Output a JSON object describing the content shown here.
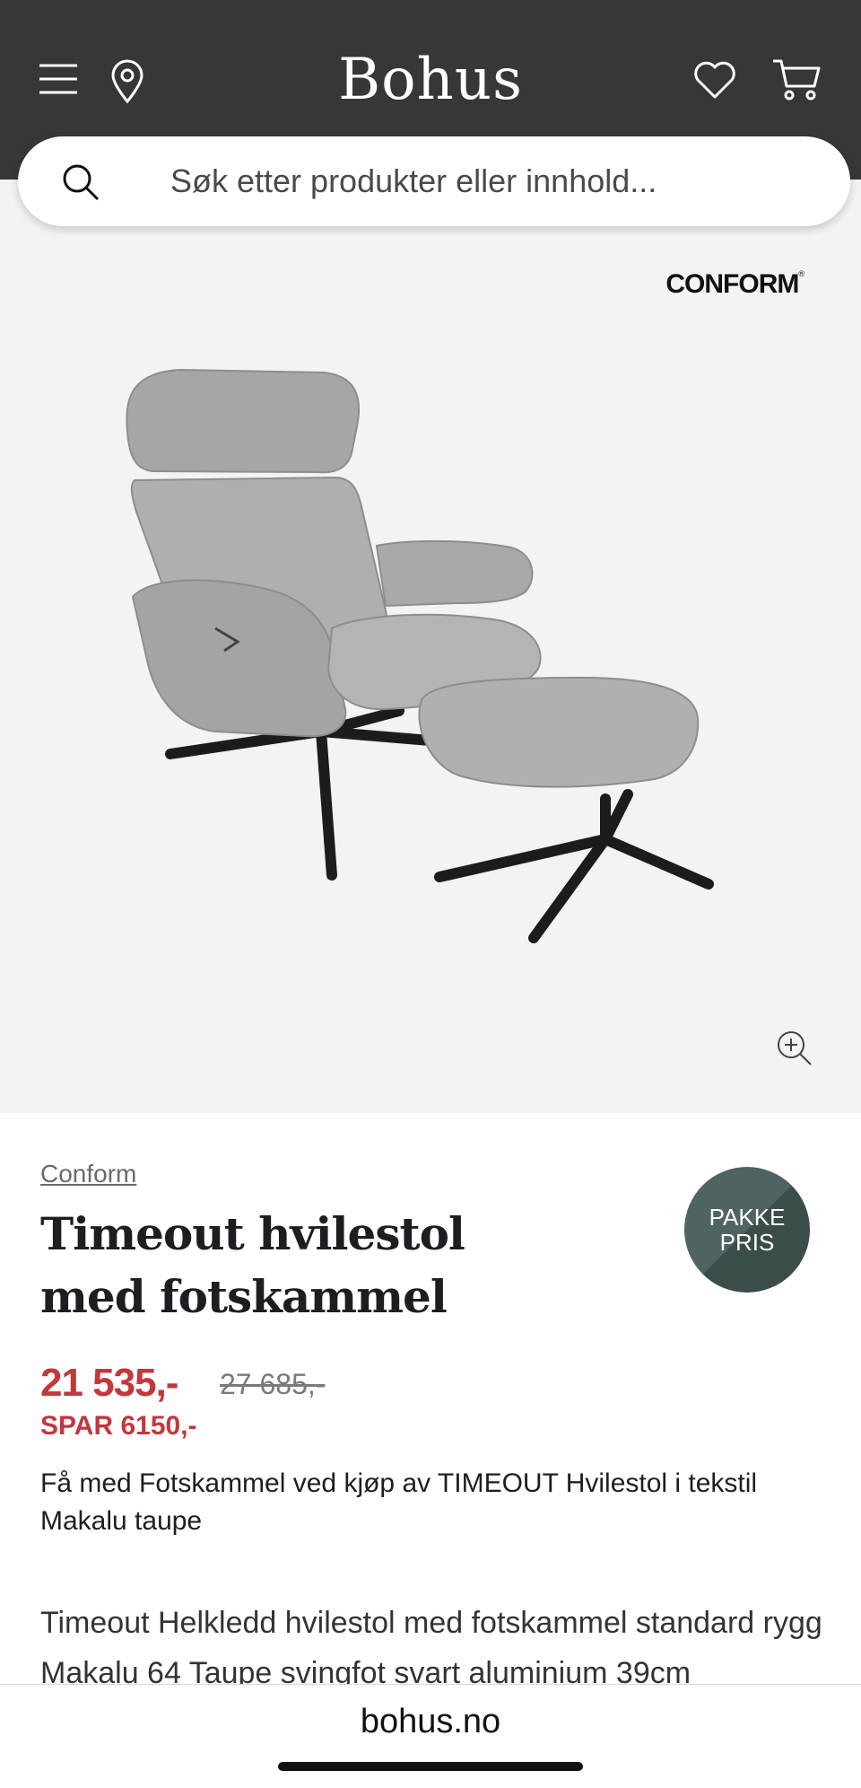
{
  "header": {
    "logo": "Bohus",
    "menu_icon": "hamburger-menu-icon",
    "location_icon": "map-pin-icon",
    "wishlist_icon": "heart-icon",
    "cart_icon": "shopping-cart-icon",
    "background": "#37373a"
  },
  "search": {
    "placeholder": "Søk etter produkter eller innhold...",
    "icon": "search-icon"
  },
  "gallery": {
    "brand_logo": "CONFORM",
    "zoom_icon": "zoom-in-icon",
    "background": "#f4f3f2"
  },
  "product": {
    "brand": "Conform",
    "title": "Timeout hvilestol med fotskammel",
    "badge": {
      "line1": "PAKKE",
      "line2": "PRIS"
    },
    "price_now": "21 535,-",
    "price_old": "27 685,-",
    "saving": "SPAR 6150,-",
    "promo": "Få med Fotskammel ved kjøp av TIMEOUT Hvilestol i tekstil Makalu taupe",
    "description": "Timeout Helkledd hvilestol med fotskammel standard rygg Makalu 64 Taupe svingfot svart aluminium 39cm"
  },
  "browser": {
    "url": "bohus.no"
  },
  "colors": {
    "price": "#c1383d",
    "badge": "#4f6462"
  }
}
